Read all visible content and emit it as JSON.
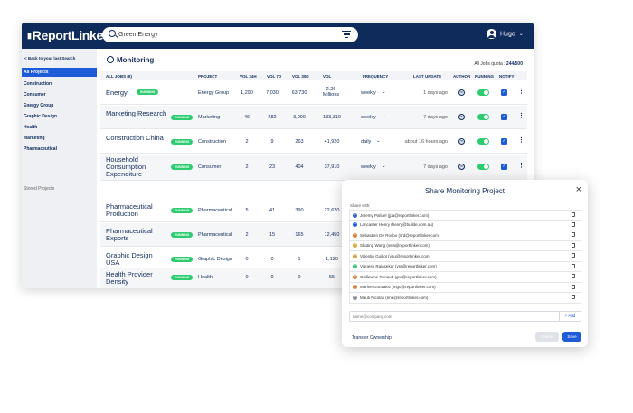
{
  "topbar": {
    "logo": "ReportLinker",
    "search_value": "Green Energy",
    "user_name": "Hugo"
  },
  "sidebar": {
    "back_label": "< Back to your last Search",
    "items": [
      "All Projects",
      "Construction",
      "Consumer",
      "Energy Group",
      "Graphic Design",
      "Health",
      "Marketing",
      "Pharmaceutical"
    ],
    "stored_label": "Stored Projects"
  },
  "main": {
    "title": "Monitoring",
    "quota_label": "All Jobs quota :",
    "quota_value": "244/500",
    "columns": [
      "ALL JOBS (8)",
      "PROJECT",
      "VOL 24H",
      "VOL 7D",
      "VOL 30D",
      "VOL",
      "FREQUENCY",
      "LAST UPDATE",
      "AUTHOR",
      "RUNNING",
      "NOTIFY"
    ],
    "rows": [
      {
        "name": "Energy",
        "status": "RUNNING",
        "project": "Energy Group",
        "v24": "1,290",
        "v7": "7,030",
        "v30": "63,730",
        "vol": "2.26 Millions",
        "freq": "weekly",
        "updated": "1 days ago",
        "author": "HC"
      },
      {
        "name": "Marketing Research",
        "status": "RUNNING",
        "project": "Marketing",
        "v24": "46",
        "v7": "282",
        "v30": "3,090",
        "vol": "133,310",
        "freq": "weekly",
        "updated": "7 days ago",
        "author": "HC"
      },
      {
        "name": "Construction China",
        "status": "RUNNING",
        "project": "Construction",
        "v24": "2",
        "v7": "9",
        "v30": "263",
        "vol": "41,920",
        "freq": "daily",
        "updated": "about 16 hours ago",
        "author": "HC"
      },
      {
        "name": "Household Consumption Expenditure",
        "status": "RUNNING",
        "project": "Consumer",
        "v24": "2",
        "v7": "23",
        "v30": "404",
        "vol": "37,910",
        "freq": "weekly",
        "updated": "7 days ago",
        "author": "HC"
      },
      {
        "name": "Pharmaceutical Production",
        "status": "RUNNING",
        "project": "Pharmaceutical",
        "v24": "5",
        "v7": "41",
        "v30": "390",
        "vol": "22,620",
        "freq": "",
        "updated": "",
        "author": ""
      },
      {
        "name": "Pharmaceutical Exports",
        "status": "RUNNING",
        "project": "Pharmaceutical",
        "v24": "2",
        "v7": "15",
        "v30": "165",
        "vol": "12,450",
        "freq": "",
        "updated": "",
        "author": ""
      },
      {
        "name": "Graphic Design USA",
        "status": "RUNNING",
        "project": "Graphic Design",
        "v24": "0",
        "v7": "0",
        "v30": "1",
        "vol": "1,120",
        "freq": "",
        "updated": "",
        "author": ""
      },
      {
        "name": "Health Provider Density",
        "status": "RUNNING",
        "project": "Health",
        "v24": "0",
        "v7": "0",
        "v30": "0",
        "vol": "55",
        "freq": "",
        "updated": "",
        "author": ""
      }
    ]
  },
  "modal": {
    "title": "Share Monitoring Project",
    "share_with_label": "Share with:",
    "members": [
      {
        "initials": "JP",
        "email": "Jeremy Paliuel (jpa@reportlinker.com)",
        "color": "#3b5bd9"
      },
      {
        "initials": "LH",
        "email": "Lancaster Henry (henry@builde.com.au)",
        "color": "#1d5bd8"
      },
      {
        "initials": "SD",
        "email": "Sébastien De Rosbo (srd@reportlinker.com)",
        "color": "#e07b39"
      },
      {
        "initials": "SW",
        "email": "Shuting Wang (swa@reportlinker.com)",
        "color": "#e0a33b"
      },
      {
        "initials": "VG",
        "email": "Valentin Guillot (vgu@reportlinker.com)",
        "color": "#e0a33b"
      },
      {
        "initials": "VR",
        "email": "Vignesh Rajasekar (vra@reportlinker.com)",
        "color": "#2ecc71"
      },
      {
        "initials": "GR",
        "email": "Guillaume Renaud (gre@reportlinker.com)",
        "color": "#e07b39"
      },
      {
        "initials": "MG",
        "email": "Marine Gonzalez (mgo@reportlinker.com)",
        "color": "#e07b39"
      },
      {
        "initials": "MN",
        "email": "Mauti Nicolas (nna@reportlinker.com)",
        "color": "#8a8fa3"
      }
    ],
    "email_placeholder": "name@company.com",
    "add_label": "+ Add",
    "transfer_label": "Transfer Ownership",
    "cancel_label": "Cancel",
    "save_label": "Save"
  }
}
